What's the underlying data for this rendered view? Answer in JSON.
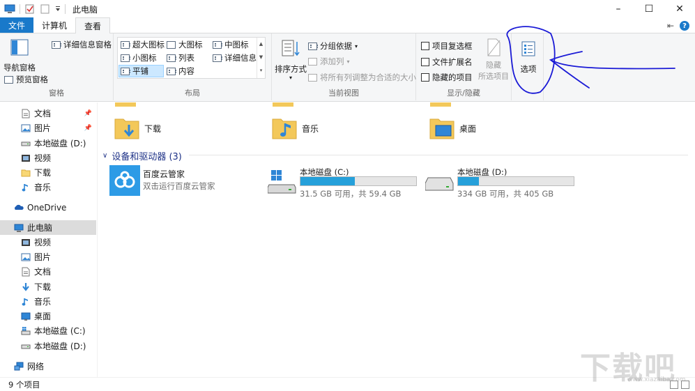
{
  "window": {
    "title": "此电脑",
    "minimize": "–",
    "maximize": "☐",
    "close": "✕"
  },
  "tabs": {
    "file": "文件",
    "computer": "计算机",
    "view": "查看",
    "collapse": "⇤",
    "help": "?"
  },
  "ribbon": {
    "pane": {
      "nav_pane": "导航窗格",
      "details_pane": "详细信息窗格",
      "preview_pane": "预览窗格",
      "label": "窗格"
    },
    "layout": {
      "items": [
        "超大图标",
        "大图标",
        "中图标",
        "小图标",
        "列表",
        "详细信息",
        "平铺",
        "内容"
      ],
      "label": "布局"
    },
    "current_view": {
      "sort_by": "排序方式",
      "group_by": "分组依据",
      "add_columns": "添加列",
      "fit_columns": "将所有列调整为合适的大小",
      "label": "当前视图"
    },
    "show_hide": {
      "item_checkboxes": "项目复选框",
      "file_extensions": "文件扩展名",
      "hidden_items": "隐藏的项目",
      "hide": "隐藏",
      "selected_items": "所选项目",
      "label": "显示/隐藏"
    },
    "options": {
      "label": "选项"
    }
  },
  "nav": {
    "items": [
      {
        "label": "文档",
        "pinned": true
      },
      {
        "label": "图片",
        "pinned": true
      },
      {
        "label": "本地磁盘 (D:)"
      },
      {
        "label": "视频"
      },
      {
        "label": "下载"
      },
      {
        "label": "音乐"
      },
      {
        "label": "OneDrive"
      },
      {
        "label": "此电脑"
      },
      {
        "label": "视频"
      },
      {
        "label": "图片"
      },
      {
        "label": "文档"
      },
      {
        "label": "下载"
      },
      {
        "label": "音乐"
      },
      {
        "label": "桌面"
      },
      {
        "label": "本地磁盘 (C:)"
      },
      {
        "label": "本地磁盘 (D:)"
      },
      {
        "label": "网络"
      }
    ],
    "pin_glyph": "📌"
  },
  "content": {
    "folders": [
      "下载",
      "音乐",
      "桌面"
    ],
    "section_title": "设备和驱动器 (3)",
    "section_chevron": "∨",
    "app": {
      "name": "百度云管家",
      "subtitle": "双击运行百度云管家"
    },
    "drives": [
      {
        "name": "本地磁盘 (C:)",
        "free_text": "31.5 GB 可用，共 59.4 GB",
        "used_fraction": 0.47
      },
      {
        "name": "本地磁盘 (D:)",
        "free_text": "334 GB 可用，共 405 GB",
        "used_fraction": 0.18
      }
    ]
  },
  "status": {
    "count": "9 个项目"
  },
  "watermark": {
    "logo_text": "下载吧",
    "url": "www.xiazaiba.com"
  },
  "colors": {
    "accent": "#1979ca",
    "selection": "#cce8ff",
    "drive_fill": "#26a0da",
    "annotation_ink": "#1a1ad6"
  }
}
